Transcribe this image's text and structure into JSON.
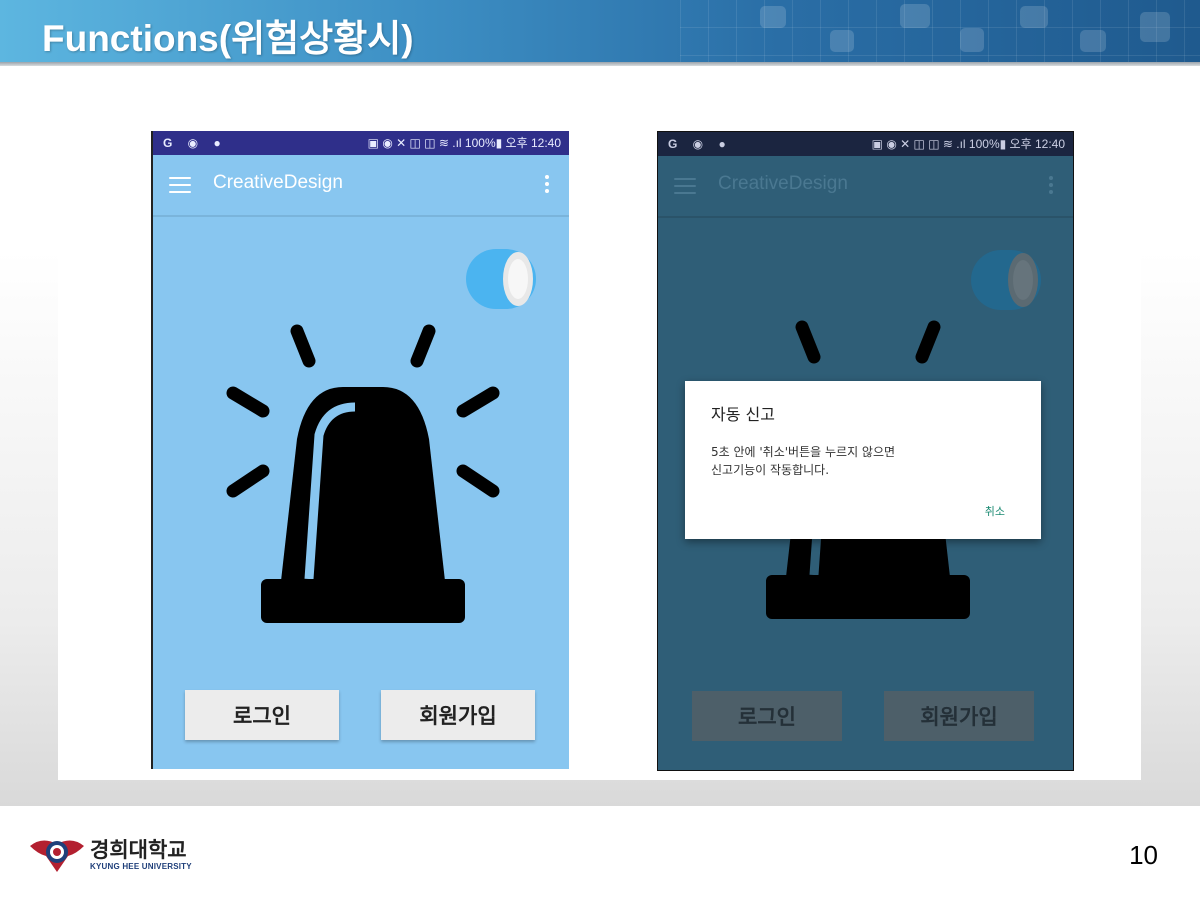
{
  "slide": {
    "title": "Functions(위험상황시)",
    "page_number": "10"
  },
  "phone_normal": {
    "status_icons_left": "G ◉ ●",
    "status_text": "▣ ◉ ✕ ◫ ◫ ≋ .ıl 100%▮ 오후 12:40",
    "app_title": "CreativeDesign",
    "login_button": "로그인",
    "signup_button": "회원가입",
    "toggle_state": "on"
  },
  "phone_alert": {
    "status_icons_left": "G ◉ ●",
    "status_text": "▣ ◉ ✕ ◫ ◫ ≋ .ıl 100%▮ 오후 12:40",
    "app_title": "CreativeDesign",
    "login_button": "로그인",
    "signup_button": "회원가입",
    "dialog": {
      "title": "자동 신고",
      "message": "5초 안에 '취소'버튼을 누르지 않으면\n신고기능이 작동합니다.",
      "cancel_label": "취소"
    }
  },
  "footer": {
    "logo_name": "경희대학교",
    "logo_sub": "KYUNG HEE UNIVERSITY"
  },
  "colors": {
    "header_blue": "#3d8fc4",
    "phone_bg": "#88c6f0",
    "dim_bg": "#2f5e77",
    "toggle_on": "#4bb4f0",
    "dialog_accent": "#1b8a72"
  }
}
